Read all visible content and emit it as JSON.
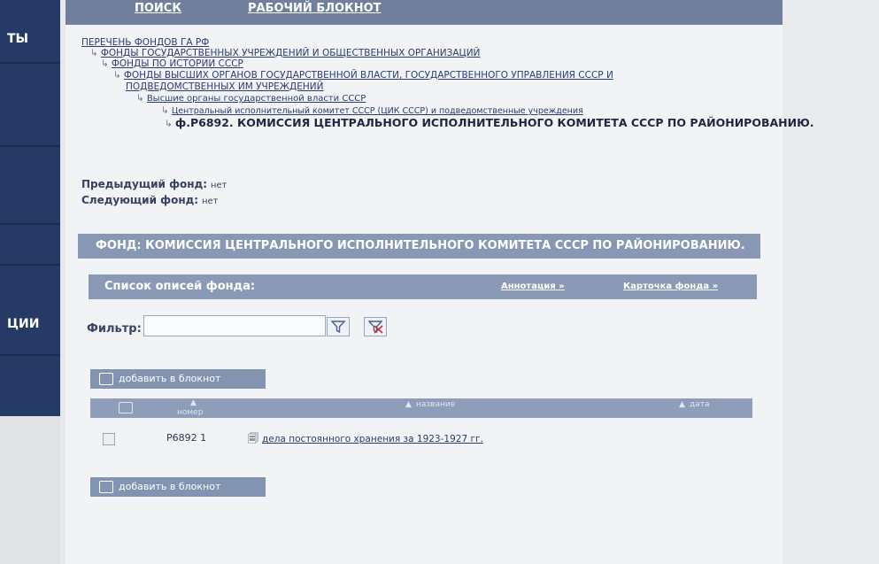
{
  "sidebar": {
    "items": [
      {
        "label": "ТЫ"
      },
      {
        "label": ""
      },
      {
        "label": ""
      },
      {
        "label": ""
      },
      {
        "label": "ЦИИ"
      }
    ]
  },
  "topnav": {
    "search": "ПОИСК",
    "notebook": "РАБОЧИЙ БЛОКНОТ"
  },
  "breadcrumbs": [
    "ПЕРЕЧЕНЬ ФОНДОВ ГА РФ",
    "ФОНДЫ ГОСУДАРСТВЕННЫХ УЧРЕЖДЕНИЙ И ОБЩЕСТВЕННЫХ ОРГАНИЗАЦИЙ",
    "ФОНДЫ ПО ИСТОРИИ СССР",
    "ФОНДЫ ВЫСШИХ ОРГАНОВ ГОСУДАРСТВЕННОЙ ВЛАСТИ, ГОСУДАРСТВЕННОГО УПРАВЛЕНИЯ СССР И",
    "ПОДВЕДОМСТВЕННЫХ ИМ УЧРЕЖДЕНИЙ",
    "Высшие органы государственной власти СССР",
    "Центральный исполнительный комитет СССР (ЦИК СССР) и подведомственные учреждения",
    "ф.Р6892. КОМИССИЯ ЦЕНТРАЛЬНОГО ИСПОЛНИТЕЛЬНОГО КОМИТЕТА СССР ПО РАЙОНИРОВАНИЮ."
  ],
  "meta": {
    "prev_label": "Предыдущий фонд:",
    "prev_value": "нет",
    "next_label": "Следующий фонд:",
    "next_value": "нет"
  },
  "fund_title": "ФОНД: КОМИССИЯ ЦЕНТРАЛЬНОГО ИСПОЛНИТЕЛЬНОГО КОМИТЕТА СССР ПО РАЙОНИРОВАНИЮ.",
  "list": {
    "title": "Список описей фонда:",
    "annotation_link": "Аннотация",
    "card_link": "Карточка фонда",
    "link_arrow": "»"
  },
  "filter": {
    "label": "Фильтр:",
    "value": ""
  },
  "add_to_notebook": "добавить в блокнот",
  "table": {
    "columns": [
      "номер",
      "название",
      "дата"
    ],
    "sort_marker": "▲",
    "rows": [
      {
        "number": "Р6892 1",
        "name": "дела постоянного хранения за 1923-1927 гг.",
        "date": ""
      }
    ]
  }
}
